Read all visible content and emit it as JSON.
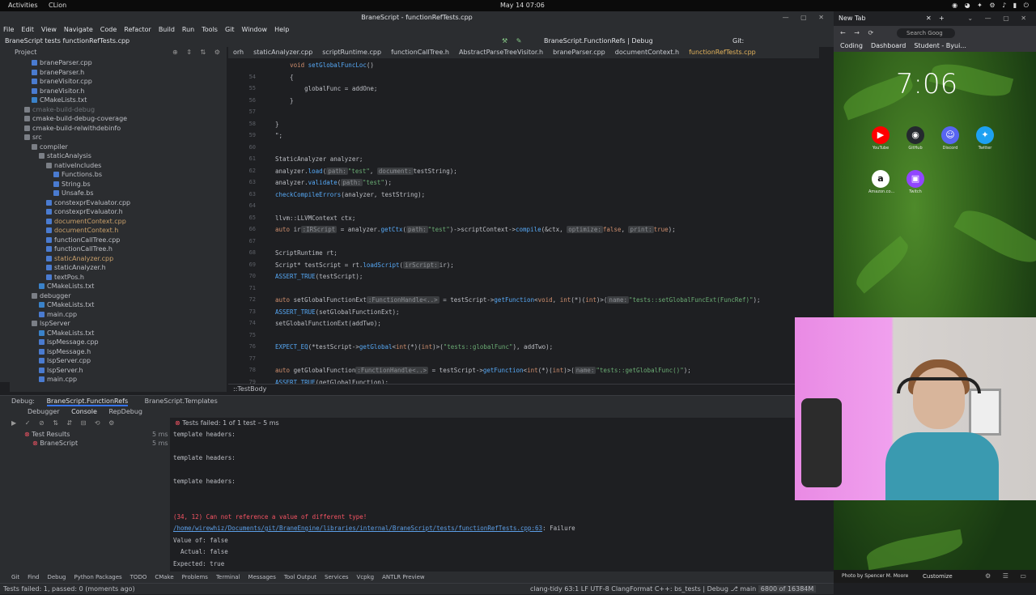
{
  "system": {
    "activities": "Activities",
    "app_name": "CLion",
    "clock": "May 14  07:06",
    "tray": "◉ ◕ ✦ ⚙ ♪ ▮ ⏻"
  },
  "ide": {
    "window_title": "BraneScript - functionRefTests.cpp",
    "menu": [
      "File",
      "Edit",
      "View",
      "Navigate",
      "Code",
      "Refactor",
      "Build",
      "Run",
      "Tools",
      "Git",
      "Window",
      "Help"
    ],
    "breadcrumb_nav": "BraneScript  tests  functionRefTests.cpp",
    "run_config": "BraneScript.FunctionRefs | Debug",
    "git_label": "Git:",
    "project_label": "Project",
    "tree": [
      {
        "label": "braneParser.cpp",
        "indent": 3,
        "kind": "file",
        "y": 0
      },
      {
        "label": "braneParser.h",
        "indent": 3,
        "kind": "file",
        "y": 1
      },
      {
        "label": "braneVisitor.cpp",
        "indent": 3,
        "kind": "file",
        "y": 2
      },
      {
        "label": "braneVisitor.h",
        "indent": 3,
        "kind": "file",
        "y": 3
      },
      {
        "label": "CMakeLists.txt",
        "indent": 3,
        "kind": "cmake",
        "y": 4
      },
      {
        "label": "cmake-build-debug",
        "indent": 2,
        "kind": "folder",
        "y": 5,
        "style": "dim"
      },
      {
        "label": "cmake-build-debug-coverage",
        "indent": 2,
        "kind": "folder",
        "y": 6
      },
      {
        "label": "cmake-build-relwithdebinfo",
        "indent": 2,
        "kind": "folder",
        "y": 7
      },
      {
        "label": "src",
        "indent": 2,
        "kind": "folder",
        "y": 8
      },
      {
        "label": "compiler",
        "indent": 3,
        "kind": "folder",
        "y": 9
      },
      {
        "label": "staticAnalysis",
        "indent": 4,
        "kind": "folder",
        "y": 10
      },
      {
        "label": "nativeIncludes",
        "indent": 5,
        "kind": "folder",
        "y": 11
      },
      {
        "label": "Functions.bs",
        "indent": 6,
        "kind": "file",
        "y": 12
      },
      {
        "label": "String.bs",
        "indent": 6,
        "kind": "file",
        "y": 13
      },
      {
        "label": "Unsafe.bs",
        "indent": 6,
        "kind": "file",
        "y": 14
      },
      {
        "label": "constexprEvaluator.cpp",
        "indent": 5,
        "kind": "file",
        "y": 15
      },
      {
        "label": "constexprEvaluator.h",
        "indent": 5,
        "kind": "file",
        "y": 16
      },
      {
        "label": "documentContext.cpp",
        "indent": 5,
        "kind": "file",
        "y": 17,
        "style": "link"
      },
      {
        "label": "documentContext.h",
        "indent": 5,
        "kind": "file",
        "y": 18,
        "style": "link"
      },
      {
        "label": "functionCallTree.cpp",
        "indent": 5,
        "kind": "file",
        "y": 19
      },
      {
        "label": "functionCallTree.h",
        "indent": 5,
        "kind": "file",
        "y": 20
      },
      {
        "label": "staticAnalyzer.cpp",
        "indent": 5,
        "kind": "file",
        "y": 21,
        "style": "link"
      },
      {
        "label": "staticAnalyzer.h",
        "indent": 5,
        "kind": "file",
        "y": 22
      },
      {
        "label": "textPos.h",
        "indent": 5,
        "kind": "file",
        "y": 23
      },
      {
        "label": "CMakeLists.txt",
        "indent": 4,
        "kind": "cmake",
        "y": 24
      },
      {
        "label": "debugger",
        "indent": 3,
        "kind": "folder",
        "y": 25
      },
      {
        "label": "CMakeLists.txt",
        "indent": 4,
        "kind": "cmake",
        "y": 26
      },
      {
        "label": "main.cpp",
        "indent": 4,
        "kind": "file",
        "y": 27
      },
      {
        "label": "lspServer",
        "indent": 3,
        "kind": "folder",
        "y": 28
      },
      {
        "label": "CMakeLists.txt",
        "indent": 4,
        "kind": "cmake",
        "y": 29
      },
      {
        "label": "lspMessage.cpp",
        "indent": 4,
        "kind": "file",
        "y": 30
      },
      {
        "label": "lspMessage.h",
        "indent": 4,
        "kind": "file",
        "y": 31
      },
      {
        "label": "lspServer.cpp",
        "indent": 4,
        "kind": "file",
        "y": 32
      },
      {
        "label": "lspServer.h",
        "indent": 4,
        "kind": "file",
        "y": 33
      },
      {
        "label": "main.cpp",
        "indent": 4,
        "kind": "file",
        "y": 34
      }
    ],
    "tabs": [
      {
        "label": "orh",
        "active": false
      },
      {
        "label": "staticAnalyzer.cpp",
        "active": false
      },
      {
        "label": "scriptRuntime.cpp",
        "active": false
      },
      {
        "label": "functionCallTree.h",
        "active": false
      },
      {
        "label": "AbstractParseTreeVisitor.h",
        "active": false
      },
      {
        "label": "braneParser.cpp",
        "active": false
      },
      {
        "label": "documentContext.h",
        "active": false
      },
      {
        "label": "functionRefTests.cpp",
        "active": true
      }
    ],
    "code_lines": [
      {
        "n": "",
        "html": "    <span class='kw'>void</span> <span class='fn'>setGlobalFuncLoc</span>()"
      },
      {
        "n": "54",
        "html": "    {"
      },
      {
        "n": "55",
        "html": "        globalFunc = addOne;"
      },
      {
        "n": "56",
        "html": "    }"
      },
      {
        "n": "57",
        "html": ""
      },
      {
        "n": "58",
        "html": "}"
      },
      {
        "n": "59",
        "html": "\";"
      },
      {
        "n": "60",
        "html": ""
      },
      {
        "n": "61",
        "html": "StaticAnalyzer analyzer;"
      },
      {
        "n": "62",
        "html": "analyzer.<span class='fn'>load</span>(<span class='hint'>path:</span><span class='str'>\"test\"</span>, <span class='hint'>document:</span>testString);"
      },
      {
        "n": "63",
        "html": "analyzer.<span class='fn'>validate</span>(<span class='hint'>path:</span><span class='str'>\"test\"</span>);"
      },
      {
        "n": "63",
        "html": "<span class='fn'>checkCompileErrors</span>(analyzer, testString);"
      },
      {
        "n": "64",
        "html": ""
      },
      {
        "n": "65",
        "html": "llvm::LLVMContext ctx;"
      },
      {
        "n": "66",
        "html": "<span class='kw'>auto</span> ir<span class='hint'>:IRScript</span> = analyzer.<span class='fn'>getCtx</span>(<span class='hint'>path:</span><span class='str'>\"test\"</span>)->scriptContext-><span class='fn'>compile</span>(&ctx, <span class='hint'>optimize:</span><span class='kw'>false</span>, <span class='hint'>print:</span><span class='kw'>true</span>);"
      },
      {
        "n": "67",
        "html": ""
      },
      {
        "n": "68",
        "html": "ScriptRuntime rt;"
      },
      {
        "n": "69",
        "html": "Script* testScript = rt.<span class='fn'>loadScript</span>(<span class='hint'>irScript:</span>ir);"
      },
      {
        "n": "70",
        "html": "<span class='fn'>ASSERT_TRUE</span>(testScript);"
      },
      {
        "n": "71",
        "html": ""
      },
      {
        "n": "72",
        "html": "<span class='kw'>auto</span> setGlobalFunctionExt<span class='hint'>:FunctionHandle<..></span> = testScript-><span class='fn'>getFunction</span><<span class='kw'>void</span>, <span class='kw'>int</span>(*)(<span class='kw'>int</span>)>(<span class='hint'>name:</span><span class='str'>\"tests::setGlobalFuncExt(FuncRef<int, int>)\"</span>);"
      },
      {
        "n": "73",
        "html": "<span class='fn'>ASSERT_TRUE</span>(setGlobalFunctionExt);"
      },
      {
        "n": "74",
        "html": "setGlobalFunctionExt(addTwo);"
      },
      {
        "n": "75",
        "html": ""
      },
      {
        "n": "76",
        "html": "<span class='fn'>EXPECT_EQ</span>(*testScript-><span class='fn'>getGlobal</span><<span class='kw'>int</span>(*)(<span class='kw'>int</span>)>(<span class='str'>\"tests::globalFunc\"</span>), addTwo);"
      },
      {
        "n": "77",
        "html": ""
      },
      {
        "n": "78",
        "html": "<span class='kw'>auto</span> getGlobalFunction<span class='hint'>:FunctionHandle<..></span> = testScript-><span class='fn'>getFunction</span><<span class='kw'>int</span>(*)(<span class='kw'>int</span>)>(<span class='hint'>name:</span><span class='str'>\"tests::getGlobalFunc()\"</span>);"
      },
      {
        "n": "79",
        "html": "<span class='fn'>ASSERT_TRUE</span>(getGlobalFunction);"
      },
      {
        "n": "80",
        "html": ""
      }
    ],
    "editor_crumb": "::TestBody",
    "debug": {
      "label": "Debug:",
      "tab1": "BraneScript.FunctionRefs",
      "tab2": "BraneScript.Templates",
      "sub_debugger": "Debugger",
      "sub_console": "Console",
      "sub_repdebug": "RepDebug",
      "tests_failed": "Tests failed: 1 of 1 test – 5 ms",
      "test_results": "Test Results",
      "test_results_time": "5 ms",
      "branescript": "BraneScript",
      "branescript_time": "5 ms",
      "console_lines": [
        {
          "text": "template headers:",
          "cls": ""
        },
        {
          "text": "",
          "cls": ""
        },
        {
          "text": "template headers:",
          "cls": ""
        },
        {
          "text": "",
          "cls": ""
        },
        {
          "text": "template headers:",
          "cls": ""
        },
        {
          "text": "",
          "cls": ""
        },
        {
          "text": "",
          "cls": ""
        },
        {
          "text": "(34, 12) Can not reference a value of different type!",
          "cls": "err"
        },
        {
          "text": "/home/wirewhiz/Documents/git/BraneEngine/libraries/internal/BraneScript/tests/functionRefTests.cpp:63",
          "cls": "lnk",
          "suffix": ": Failure"
        },
        {
          "text": "Value of: false",
          "cls": ""
        },
        {
          "text": "  Actual: false",
          "cls": ""
        },
        {
          "text": "Expected: true",
          "cls": ""
        }
      ]
    },
    "tool_windows": [
      "Git",
      "Find",
      "Debug",
      "Python Packages",
      "TODO",
      "CMake",
      "Problems",
      "Terminal",
      "Messages",
      "Tool Output",
      "Services",
      "Vcpkg",
      "ANTLR Preview"
    ],
    "status_left": "Tests failed: 1, passed: 0 (moments ago)",
    "status_right": "clang-tidy   63:1   LF   UTF-8   ClangFormat   C++: bs_tests | Debug   ⎇ main",
    "status_mem": "6800 of 16384M"
  },
  "browser": {
    "tab_title": "New Tab",
    "bookmarks": [
      "Coding",
      "Dashboard",
      "Student - Byui..."
    ],
    "search_placeholder": "Search Goog",
    "clock": "7:06",
    "shortcuts": [
      {
        "label": "YouTube",
        "color": "#ff0000",
        "glyph": "▶"
      },
      {
        "label": "GitHub",
        "color": "#24292e",
        "glyph": "◉"
      },
      {
        "label": "Discord",
        "color": "#5865f2",
        "glyph": "☺"
      },
      {
        "label": "Twitter",
        "color": "#1da1f2",
        "glyph": "✦"
      },
      {
        "label": "Amazon.co...",
        "color": "#ffffff",
        "glyph": "a"
      },
      {
        "label": "Twitch",
        "color": "#9146ff",
        "glyph": "▣"
      }
    ],
    "footer_credit": "Photo by Spencer M. Moore",
    "customize": "Customize"
  }
}
